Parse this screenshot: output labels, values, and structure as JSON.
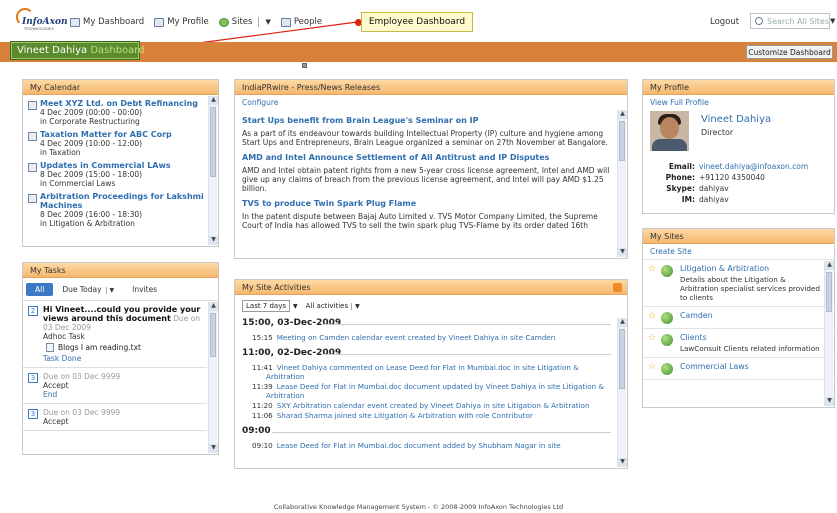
{
  "header": {
    "logo_text": "InfoAxon",
    "logo_sub": "TECHNOLOGIES",
    "nav": [
      {
        "label": "My Dashboard"
      },
      {
        "label": "My Profile"
      },
      {
        "label": "Sites"
      },
      {
        "label": "People"
      }
    ],
    "callout": "Employee Dashboard",
    "logout": "Logout",
    "search_placeholder": "Search All Sites"
  },
  "band": {
    "user_name": "Vineet Dahiya",
    "dashboard_word": "Dashboard",
    "customize_label": "Customize Dashboard"
  },
  "calendar": {
    "title": "My Calendar",
    "items": [
      {
        "title": "Meet XYZ Ltd. on Debt Refinancing",
        "time": "4 Dec 2009 (00:00 - 00:00)",
        "site": "in Corporate Restructuring"
      },
      {
        "title": "Taxation Matter for ABC Corp",
        "time": "4 Dec 2009 (10:00 - 12:00)",
        "site": "in Taxation"
      },
      {
        "title": "Updates in Commercial LAws",
        "time": "8 Dec 2009 (15:00 - 18:00)",
        "site": "in Commercial Laws"
      },
      {
        "title": "Arbitration Proceedings for Lakshmi Machines",
        "time": "8 Dec 2009 (16:00 - 18:30)",
        "site": "in Litigation & Arbitration"
      }
    ]
  },
  "tasks": {
    "title": "My Tasks",
    "tabs": {
      "all": "All",
      "due_today": "Due Today",
      "invites": "Invites"
    },
    "items": [
      {
        "num": "2",
        "title": "Hi Vineet....could you provide your views around this document",
        "due": "Due on 03 Dec 2009",
        "type": "Adhoc Task",
        "attachment": "Blogs I am reading.txt",
        "action": "Task Done"
      },
      {
        "num": "3",
        "due": "Due on 03 Dec 9999",
        "type": "Accept",
        "action": "End"
      },
      {
        "num": "3",
        "due": "Due on 03 Dec 9999",
        "type": "Accept"
      }
    ]
  },
  "press": {
    "title": "IndiaPRwire - Press/News Releases",
    "configure": "Configure",
    "items": [
      {
        "title": "Start Ups benefit from Brain League's Seminar on IP",
        "body": "As a part of its endeavour towards building Intellectual Property (IP) culture and hygiene among Start Ups and Entrepreneurs, Brain League organized a seminar on 27th November at Bangalore."
      },
      {
        "title": "AMD and Intel Announce Settlement of All Antitrust and IP Disputes",
        "body": "AMD and Intel obtain patent rights from a new 5-year cross license agreement, Intel and AMD will give up any claims of breach from the previous license agreement, and Intel will pay AMD $1.25 billion."
      },
      {
        "title": "TVS to produce Twin Spark Plug Flame",
        "body": "In the patent dispute between Bajaj Auto Limited v. TVS Motor Company Limited, the Supreme Court of India has allowed TVS to sell the twin spark plug TVS-Flame by its order dated 16th"
      }
    ]
  },
  "activities": {
    "title": "My Site Activities",
    "filter_range": "Last 7 days",
    "filter_type": "All activities",
    "groups": [
      {
        "date": "15:00, 03-Dec-2009",
        "rows": [
          {
            "time": "15:15",
            "text": "Meeting on Camden calendar event created by Vineet Dahiya in site Camden"
          }
        ]
      },
      {
        "date": "11:00, 02-Dec-2009",
        "rows": [
          {
            "time": "11:41",
            "text": "Vineet Dahiya commented on Lease Deed for Flat in Mumbai.doc in site Litigation & Arbitration"
          },
          {
            "time": "11:39",
            "text": "Lease Deed for Flat in Mumbai.doc document updated by Vineet Dahiya in site Litigation & Arbitration"
          },
          {
            "time": "11:20",
            "text": "SXY Arbitration calendar event created by Vineet Dahiya in site Litigation & Arbitration"
          },
          {
            "time": "11:06",
            "text": "Sharad Sharma joined site Litigation & Arbitration with role Contributor"
          }
        ]
      },
      {
        "date": "09:00",
        "rows": [
          {
            "time": "09:10",
            "text": "Lease Deed for Flat in Mumbai.doc document added by Shubham Nagar in site"
          }
        ]
      }
    ]
  },
  "profile": {
    "title": "My Profile",
    "view_full": "View Full Profile",
    "name": "Vineet Dahiya",
    "role": "Director",
    "email_label": "Email:",
    "email": "vineet.dahiya@infoaxon.com",
    "phone_label": "Phone:",
    "phone": "+91120 4350040",
    "skype_label": "Skype:",
    "skype": "dahiyav",
    "im_label": "IM:",
    "im": "dahiyav"
  },
  "sites": {
    "title": "My Sites",
    "create": "Create Site",
    "items": [
      {
        "name": "Litigation & Arbitration",
        "desc": "Details about the Litigation & Arbitration specialist services provided to clients"
      },
      {
        "name": "Camden",
        "desc": ""
      },
      {
        "name": "Clients",
        "desc": "LawConsult Clients related information"
      },
      {
        "name": "Commercial Laws",
        "desc": ""
      }
    ]
  },
  "footer": "Collaborative Knowledge Management System - © 2008-2009 InfoAxon Technologies Ltd"
}
